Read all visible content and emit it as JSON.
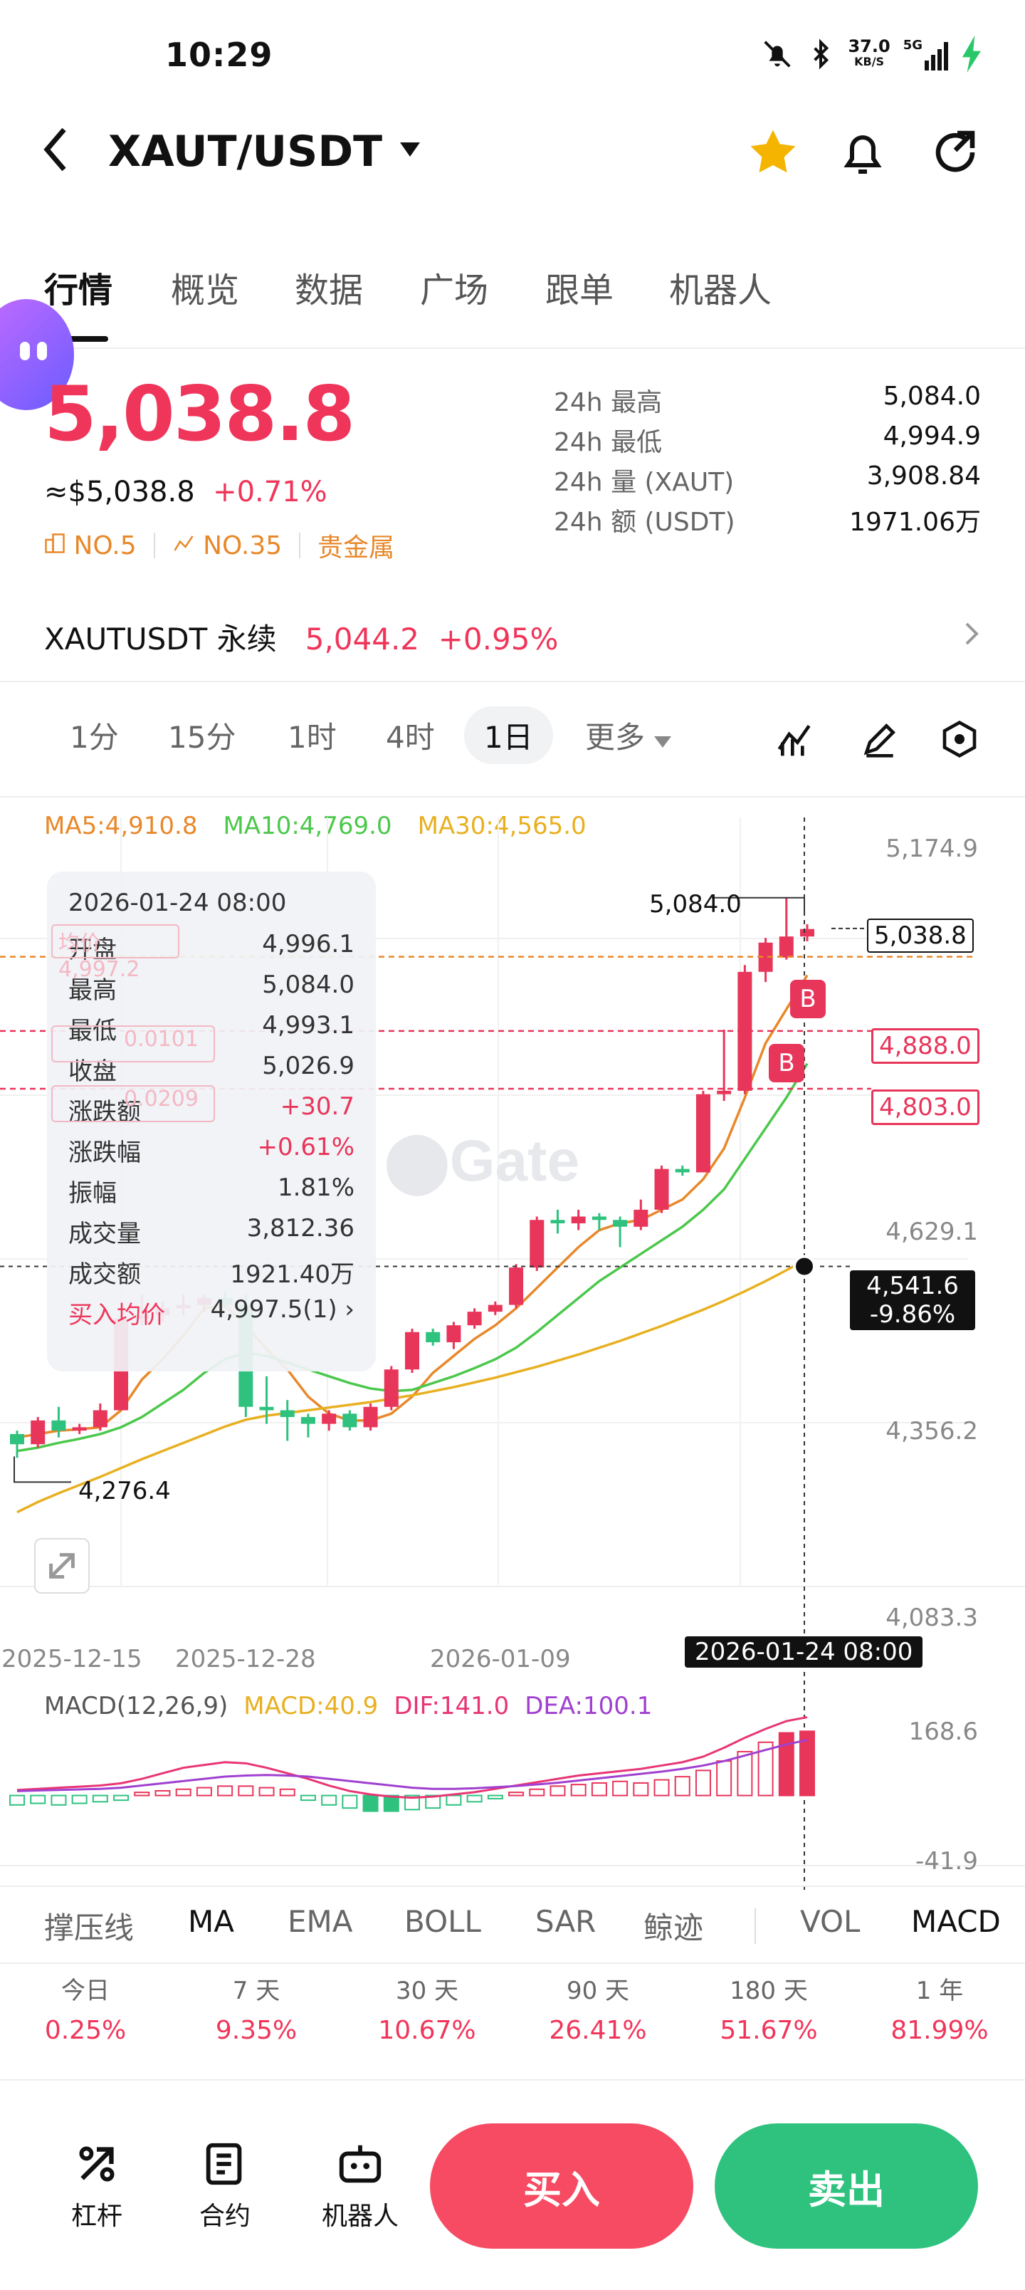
{
  "status": {
    "time": "10:29",
    "net_speed": "37.0",
    "net_unit": "KB/S",
    "signal": "5G"
  },
  "header": {
    "pair": "XAUT/USDT"
  },
  "tabs": [
    "行情",
    "概览",
    "数据",
    "广场",
    "跟单",
    "机器人"
  ],
  "price": {
    "last": "5,038.8",
    "approx": "≈$5,038.8",
    "change": "+0.71%"
  },
  "stats": [
    {
      "label": "24h  最高",
      "value": "5,084.0"
    },
    {
      "label": "24h  最低",
      "value": "4,994.9"
    },
    {
      "label": "24h  量 (XAUT)",
      "value": "3,908.84"
    },
    {
      "label": "24h  额 (USDT)",
      "value": "1971.06万"
    }
  ],
  "tags": {
    "rank1": "NO.5",
    "rank2": "NO.35",
    "category": "贵金属"
  },
  "perp": {
    "name": "XAUTUSDT 永续",
    "price": "5,044.2",
    "change": "+0.95%"
  },
  "intervals": [
    "1分",
    "15分",
    "1时",
    "4时",
    "1日",
    "更多"
  ],
  "ma": {
    "ma5": "MA5:4,910.8",
    "ma10": "MA10:4,769.0",
    "ma30": "MA30:4,565.0"
  },
  "yaxis": [
    "5,174.9",
    "4,629.1",
    "4,356.2",
    "4,083.3"
  ],
  "xaxis": [
    "2025-12-15",
    "2025-12-28",
    "2026-01-09"
  ],
  "crosshair": {
    "date": "2026-01-24 08:00",
    "price": "4,541.6",
    "pct": "-9.86%"
  },
  "marks": {
    "high": "5,084.0",
    "low": "4,276.4",
    "last": "5,038.8",
    "order1": "4,888.0",
    "order2": "4,803.0",
    "b": "B"
  },
  "hidden_labels": {
    "avg_label": "均价",
    "avg_value": "4,997.2",
    "a": "0.0101",
    "b": "0.0209"
  },
  "tooltip": {
    "date": "2026-01-24 08:00",
    "rows": [
      {
        "k": "开盘",
        "v": "4,996.1"
      },
      {
        "k": "最高",
        "v": "5,084.0"
      },
      {
        "k": "最低",
        "v": "4,993.1"
      },
      {
        "k": "收盘",
        "v": "5,026.9"
      },
      {
        "k": "涨跌额",
        "v": "+30.7"
      },
      {
        "k": "涨跌幅",
        "v": "+0.61%"
      },
      {
        "k": "振幅",
        "v": "1.81%"
      },
      {
        "k": "成交量",
        "v": "3,812.36"
      },
      {
        "k": "成交额",
        "v": "1921.40万"
      }
    ],
    "avg_label": "买入均价",
    "avg_value": "4,997.5(1)"
  },
  "macd": {
    "title": "MACD(12,26,9)",
    "macd": "MACD:40.9",
    "dif": "DIF:141.0",
    "dea": "DEA:100.1",
    "top": "168.6",
    "bottom": "-41.9"
  },
  "indicators": [
    "撑压线",
    "MA",
    "EMA",
    "BOLL",
    "SAR",
    "鲸迹",
    "VOL",
    "MACD"
  ],
  "perf": [
    {
      "l": "今日",
      "v": "0.25%"
    },
    {
      "l": "7 天",
      "v": "9.35%"
    },
    {
      "l": "30 天",
      "v": "10.67%"
    },
    {
      "l": "90 天",
      "v": "26.41%"
    },
    {
      "l": "180 天",
      "v": "51.67%"
    },
    {
      "l": "1 年",
      "v": "81.99%"
    }
  ],
  "bottom": {
    "lever": "杠杆",
    "contract": "合约",
    "robot": "机器人",
    "buy": "买入",
    "sell": "卖出"
  },
  "chart_data": {
    "type": "candlestick",
    "candles": [
      [
        4295,
        4300,
        4260,
        4280
      ],
      [
        4280,
        4320,
        4275,
        4315
      ],
      [
        4315,
        4335,
        4290,
        4300
      ],
      [
        4300,
        4310,
        4295,
        4305
      ],
      [
        4305,
        4340,
        4300,
        4330
      ],
      [
        4330,
        4470,
        4330,
        4465
      ],
      [
        4465,
        4500,
        4455,
        4470
      ],
      [
        4470,
        4490,
        4460,
        4480
      ],
      [
        4480,
        4500,
        4470,
        4485
      ],
      [
        4485,
        4500,
        4475,
        4495
      ],
      [
        4495,
        4505,
        4480,
        4485
      ],
      [
        4485,
        4500,
        4320,
        4335
      ],
      [
        4335,
        4380,
        4310,
        4330
      ],
      [
        4330,
        4345,
        4285,
        4320
      ],
      [
        4320,
        4325,
        4290,
        4310
      ],
      [
        4310,
        4330,
        4300,
        4325
      ],
      [
        4325,
        4330,
        4300,
        4305
      ],
      [
        4305,
        4340,
        4300,
        4335
      ],
      [
        4335,
        4395,
        4330,
        4390
      ],
      [
        4390,
        4450,
        4385,
        4445
      ],
      [
        4445,
        4450,
        4425,
        4430
      ],
      [
        4430,
        4460,
        4420,
        4455
      ],
      [
        4455,
        4480,
        4450,
        4475
      ],
      [
        4475,
        4490,
        4470,
        4485
      ],
      [
        4485,
        4545,
        4480,
        4540
      ],
      [
        4540,
        4615,
        4535,
        4610
      ],
      [
        4610,
        4625,
        4590,
        4605
      ],
      [
        4605,
        4625,
        4595,
        4615
      ],
      [
        4615,
        4620,
        4595,
        4610
      ],
      [
        4610,
        4615,
        4570,
        4600
      ],
      [
        4600,
        4640,
        4595,
        4625
      ],
      [
        4625,
        4690,
        4620,
        4685
      ],
      [
        4685,
        4690,
        4675,
        4680
      ],
      [
        4680,
        4800,
        4680,
        4795
      ],
      [
        4795,
        4890,
        4785,
        4800
      ],
      [
        4800,
        4985,
        4795,
        4975
      ],
      [
        4975,
        5025,
        4960,
        5018
      ],
      [
        4996,
        5084,
        4993,
        5027
      ],
      [
        5027,
        5045,
        5020,
        5038
      ]
    ],
    "ma5": [
      4290,
      4295,
      4300,
      4302,
      4305,
      4330,
      4375,
      4405,
      4440,
      4480,
      4485,
      4455,
      4420,
      4390,
      4350,
      4325,
      4315,
      4315,
      4325,
      4350,
      4385,
      4410,
      4435,
      4455,
      4480,
      4510,
      4540,
      4570,
      4595,
      4605,
      4610,
      4625,
      4640,
      4670,
      4715,
      4790,
      4870,
      4920,
      4970
    ],
    "ma10": [
      4270,
      4275,
      4282,
      4288,
      4295,
      4305,
      4320,
      4340,
      4360,
      4385,
      4405,
      4415,
      4410,
      4400,
      4390,
      4380,
      4370,
      4362,
      4358,
      4360,
      4370,
      4380,
      4392,
      4405,
      4422,
      4445,
      4470,
      4495,
      4520,
      4540,
      4560,
      4580,
      4600,
      4625,
      4655,
      4700,
      4745,
      4790,
      4840
    ],
    "ma30": [
      4180,
      4195,
      4208,
      4220,
      4232,
      4245,
      4258,
      4270,
      4282,
      4294,
      4306,
      4316,
      4322,
      4326,
      4330,
      4334,
      4338,
      4342,
      4347,
      4352,
      4358,
      4364,
      4371,
      4378,
      4386,
      4394,
      4403,
      4412,
      4422,
      4432,
      4443,
      4454,
      4466,
      4478,
      4491,
      4505,
      4520,
      4536,
      4552
    ]
  }
}
